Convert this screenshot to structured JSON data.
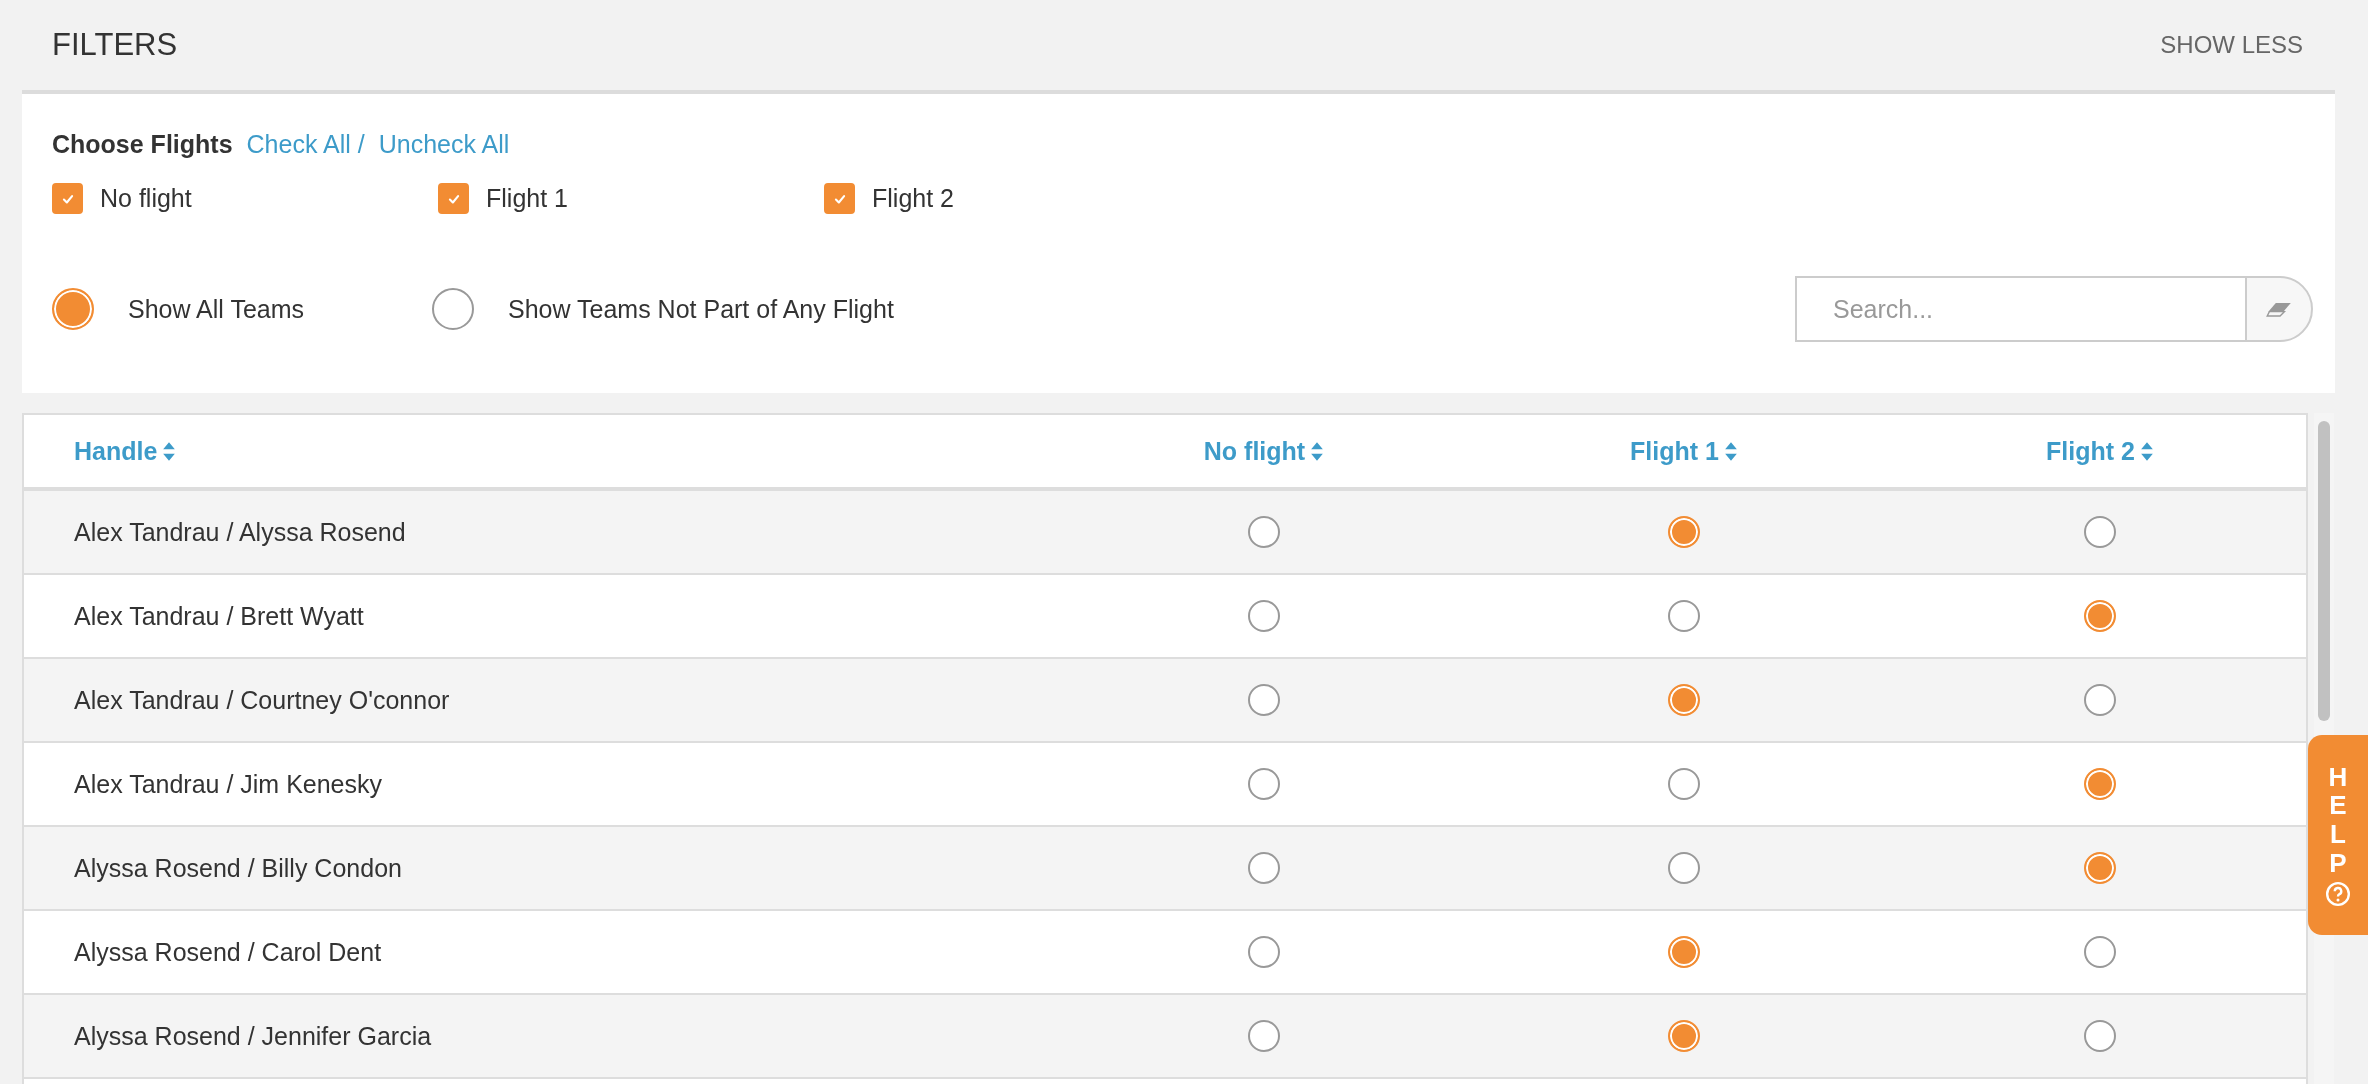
{
  "header": {
    "title": "FILTERS",
    "toggle": "SHOW LESS"
  },
  "filters": {
    "label": "Choose Flights",
    "check_all": "Check All /",
    "uncheck_all": "Uncheck All",
    "flights": [
      {
        "label": "No flight",
        "checked": true
      },
      {
        "label": "Flight 1",
        "checked": true
      },
      {
        "label": "Flight 2",
        "checked": true
      }
    ],
    "views": [
      {
        "label": "Show All Teams",
        "selected": true
      },
      {
        "label": "Show Teams Not Part of Any Flight",
        "selected": false
      }
    ],
    "search": {
      "placeholder": "Search..."
    }
  },
  "table": {
    "columns": [
      "Handle",
      "No flight",
      "Flight 1",
      "Flight 2"
    ],
    "rows": [
      {
        "handle": "Alex Tandrau / Alyssa Rosend",
        "cells": [
          {
            "selected": false
          },
          {
            "selected": true
          },
          {
            "selected": false
          }
        ]
      },
      {
        "handle": "Alex Tandrau / Brett Wyatt",
        "cells": [
          {
            "selected": false
          },
          {
            "selected": false
          },
          {
            "selected": true
          }
        ]
      },
      {
        "handle": "Alex Tandrau / Courtney O'connor",
        "cells": [
          {
            "selected": false
          },
          {
            "selected": true
          },
          {
            "selected": false
          }
        ]
      },
      {
        "handle": "Alex Tandrau / Jim Kenesky",
        "cells": [
          {
            "selected": false
          },
          {
            "selected": false
          },
          {
            "selected": true
          }
        ]
      },
      {
        "handle": "Alyssa Rosend / Billy Condon",
        "cells": [
          {
            "selected": false
          },
          {
            "selected": false
          },
          {
            "selected": true
          }
        ]
      },
      {
        "handle": "Alyssa Rosend / Carol Dent",
        "cells": [
          {
            "selected": false
          },
          {
            "selected": true
          },
          {
            "selected": false
          }
        ]
      },
      {
        "handle": "Alyssa Rosend / Jennifer Garcia",
        "cells": [
          {
            "selected": false
          },
          {
            "selected": true
          },
          {
            "selected": false
          }
        ]
      }
    ]
  },
  "help_tab": {
    "label": "HELP"
  }
}
